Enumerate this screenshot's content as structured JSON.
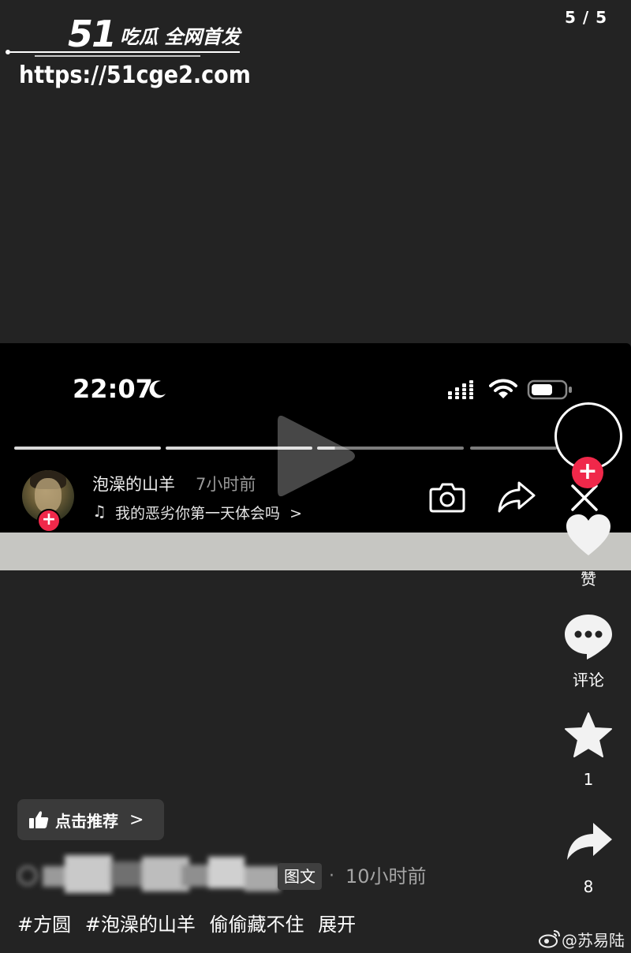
{
  "watermark": {
    "logo_number": "51",
    "logo_tagline": "吃瓜 全网首发",
    "url": "https://51cge2.com"
  },
  "page_counter": "5 / 5",
  "embedded_screen": {
    "status_bar": {
      "time": "22:07",
      "icons": [
        "moon-icon",
        "signal-icon",
        "wifi-icon",
        "battery-icon"
      ]
    },
    "story_progress_segments": 4,
    "author_name": "泡澡的山羊",
    "posted_ago": "7小时前",
    "music_title": "我的恶劣你第一天体会吗",
    "music_chevron": ">",
    "action_icons": [
      "camera-icon",
      "share-icon",
      "close-icon"
    ]
  },
  "right_rail": {
    "like_label": "赞",
    "comment_label": "评论",
    "favorite_count": "1",
    "share_count": "8"
  },
  "recommend_button": {
    "label": "点击推荐",
    "chevron": ">"
  },
  "post_meta": {
    "type_badge": "图文",
    "separator": "·",
    "time": "10小时前"
  },
  "caption": {
    "hashtag_1": "#方圆",
    "hashtag_2": "#泡澡的山羊",
    "text": "偷偷藏不住",
    "expand": "展开"
  },
  "source_watermark": {
    "handle": "@苏易陆"
  },
  "colors": {
    "background": "#232323",
    "accent": "#f0284a",
    "band": "#c6c6c2"
  }
}
